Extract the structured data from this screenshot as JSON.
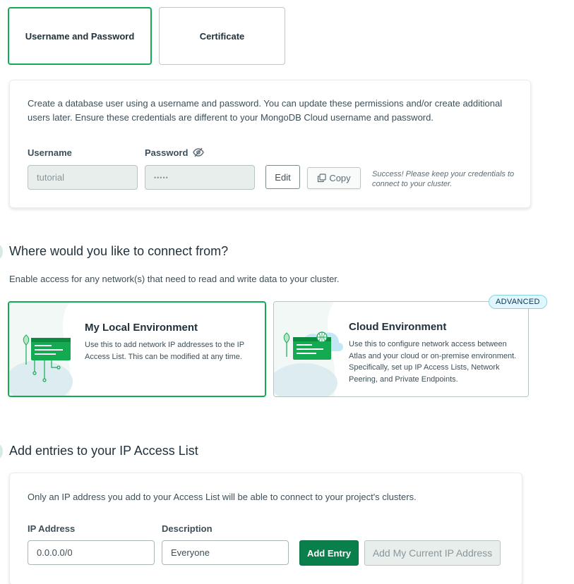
{
  "auth_tabs": {
    "username_password": "Username and Password",
    "certificate": "Certificate"
  },
  "user_panel": {
    "description": "Create a database user using a username and password. You can update these permissions and/or create additional users later. Ensure these credentials are different to your MongoDB Cloud username and password.",
    "username_label": "Username",
    "username_value": "tutorial",
    "password_label": "Password",
    "password_value": "•••••",
    "edit_label": "Edit",
    "copy_label": "Copy",
    "success_message": "Success! Please keep your credentials to connect to your cluster."
  },
  "connect_section": {
    "title": "Where would you like to connect from?",
    "subtitle": "Enable access for any network(s) that need to read and write data to your cluster.",
    "local": {
      "title": "My Local Environment",
      "description": "Use this to add network IP addresses to the IP Access List. This can be modified at any time."
    },
    "cloud": {
      "title": "Cloud Environment",
      "description": "Use this to configure network access between Atlas and your cloud or on-premise environment. Specifically, set up IP Access Lists, Network Peering, and Private Endpoints.",
      "badge": "ADVANCED"
    }
  },
  "ip_section": {
    "title": "Add entries to your IP Access List",
    "description": "Only an IP address you add to your Access List will be able to connect to your project's clusters.",
    "ip_label": "IP Address",
    "ip_value": "0.0.0.0/0",
    "description_label": "Description",
    "description_value": "Everyone",
    "add_entry_label": "Add Entry",
    "add_current_ip_label": "Add My Current IP Address"
  },
  "colors": {
    "accent_green": "#13aa52",
    "button_green": "#09804c",
    "badge_blue": "#e1f7ff"
  }
}
